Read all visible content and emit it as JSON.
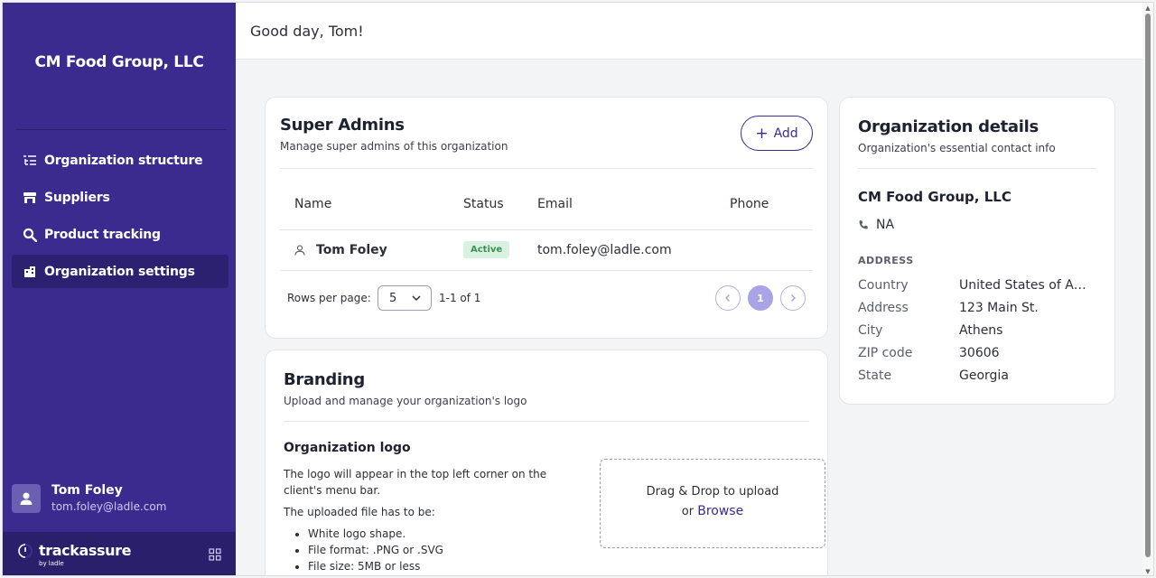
{
  "sidebar": {
    "org_name": "CM Food Group, LLC",
    "nav": [
      {
        "label": "Organization structure",
        "icon": "list-tree-icon"
      },
      {
        "label": "Suppliers",
        "icon": "store-icon"
      },
      {
        "label": "Product tracking",
        "icon": "magnifier-icon"
      },
      {
        "label": "Organization settings",
        "icon": "building-icon",
        "active": true
      }
    ],
    "user": {
      "name": "Tom Foley",
      "email": "tom.foley@ladle.com"
    },
    "brand": {
      "name": "trackassure",
      "sub": "by ladle"
    }
  },
  "header": {
    "greeting": "Good day, Tom!"
  },
  "super_admins": {
    "title": "Super Admins",
    "subtitle": "Manage super admins of this organization",
    "add_label": "Add",
    "columns": [
      "Name",
      "Status",
      "Email",
      "Phone"
    ],
    "rows": [
      {
        "name": "Tom Foley",
        "status": "Active",
        "email": "tom.foley@ladle.com",
        "phone": ""
      }
    ],
    "pager": {
      "rows_label": "Rows per page:",
      "rows_value": "5",
      "range": "1-1 of 1",
      "current_page": "1"
    }
  },
  "branding": {
    "title": "Branding",
    "subtitle": "Upload and manage your organization's logo",
    "logo_title": "Organization logo",
    "logo_desc": "The logo will appear in the top left corner on the client's menu bar.",
    "requirements_intro": "The uploaded file has to be:",
    "requirements": [
      "White logo shape.",
      "File format: .PNG or .SVG",
      "File size: 5MB or less"
    ],
    "drop_text": "Drag & Drop to upload",
    "or_text": "or",
    "browse_label": "Browse"
  },
  "org_details": {
    "title": "Organization details",
    "subtitle": "Organization's essential contact info",
    "name": "CM Food Group, LLC",
    "phone": "NA",
    "address_heading": "ADDRESS",
    "fields": [
      {
        "label": "Country",
        "value": "United States of Am…"
      },
      {
        "label": "Address",
        "value": "123 Main St."
      },
      {
        "label": "City",
        "value": "Athens"
      },
      {
        "label": "ZIP code",
        "value": "30606"
      },
      {
        "label": "State",
        "value": "Georgia"
      }
    ]
  },
  "colors": {
    "sidebar": "#3b2b8f",
    "sidebar_dark": "#2a1f6a",
    "accent": "#3b2b8f",
    "active_badge": "#d9f2df"
  }
}
